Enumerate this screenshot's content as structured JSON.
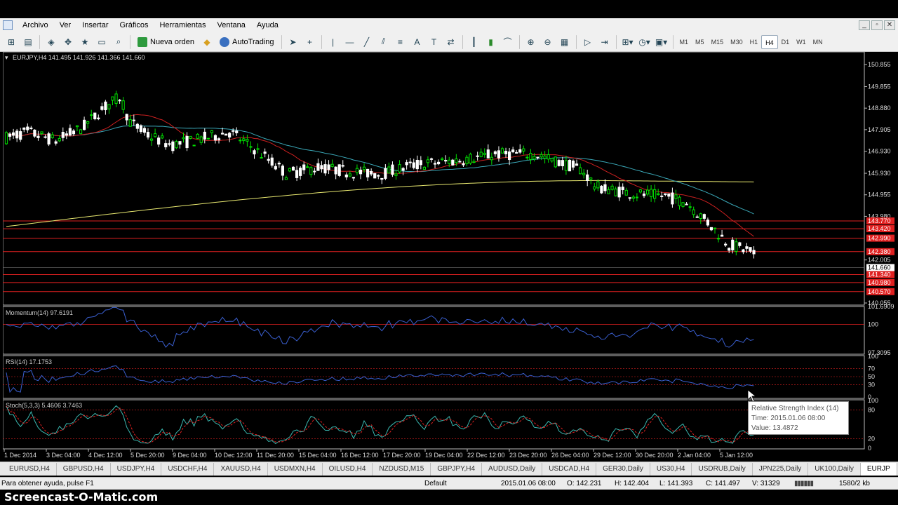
{
  "menu": [
    "Archivo",
    "Ver",
    "Insertar",
    "Gráficos",
    "Herramientas",
    "Ventana",
    "Ayuda"
  ],
  "window_controls": [
    "_",
    "▫",
    "✕"
  ],
  "toolbar": {
    "new_order": "Nueva orden",
    "autotrading": "AutoTrading",
    "timeframes": [
      "M1",
      "M5",
      "M15",
      "M30",
      "H1",
      "H4",
      "D1",
      "W1",
      "MN"
    ],
    "active_timeframe": "H4"
  },
  "chart": {
    "header": "EURJPY,H4  141.495 141.926 141.366 141.660",
    "price_axis": [
      "150.855",
      "149.855",
      "148.880",
      "147.905",
      "146.930",
      "145.930",
      "144.955",
      "143.980",
      "142.005",
      "141.660",
      "140.055"
    ],
    "red_levels": [
      {
        "price": 143.77,
        "label": "143.770"
      },
      {
        "price": 143.42,
        "label": "143.420"
      },
      {
        "price": 142.99,
        "label": "142.990"
      },
      {
        "price": 142.38,
        "label": "142.380"
      },
      {
        "price": 141.34,
        "label": "141.340"
      },
      {
        "price": 140.98,
        "label": "140.980"
      },
      {
        "price": 140.57,
        "label": "140.570"
      }
    ],
    "current_price": "141.660",
    "time_axis": [
      "1 Dec 2014",
      "3 Dec 04:00",
      "4 Dec 12:00",
      "5 Dec 20:00",
      "9 Dec 04:00",
      "10 Dec 12:00",
      "11 Dec 20:00",
      "15 Dec 04:00",
      "16 Dec 12:00",
      "17 Dec 20:00",
      "19 Dec 04:00",
      "22 Dec 12:00",
      "23 Dec 20:00",
      "26 Dec 04:00",
      "29 Dec 12:00",
      "30 Dec 20:00",
      "2 Jan 04:00",
      "5 Jan 12:00"
    ]
  },
  "momentum": {
    "label": "Momentum(14) 97.6191",
    "axis": [
      "101.6909",
      "100",
      "97.3095"
    ]
  },
  "rsi": {
    "label": "RSI(14) 17.1753",
    "axis": [
      "100",
      "70",
      "50",
      "30",
      "0"
    ]
  },
  "stoch": {
    "label": "Stoch(5,3,3) 5.4606 3.7463",
    "axis": [
      "100",
      "80",
      "20",
      "0"
    ]
  },
  "tooltip": {
    "title": "Relative Strength Index (14)",
    "time": "Time: 2015.01.06 08:00",
    "value": "Value: 13.4872"
  },
  "tabs": [
    "EURUSD,H4",
    "GBPUSD,H4",
    "USDJPY,H4",
    "USDCHF,H4",
    "XAUUSD,H4",
    "USDMXN,H4",
    "OILUSD,H4",
    "NZDUSD,M15",
    "GBPJPY,H4",
    "AUDUSD,Daily",
    "USDCAD,H4",
    "GER30,Daily",
    "US30,H4",
    "USDRUB,Daily",
    "JPN225,Daily",
    "UK100,Daily",
    "EURJP"
  ],
  "active_tab": "EURJP",
  "status": {
    "help": "Para obtener ayuda, pulse F1",
    "profile": "Default",
    "time": "2015.01.06 08:00",
    "open": "O: 142.231",
    "high": "H: 142.404",
    "low": "L: 141.393",
    "close": "C: 141.497",
    "volume": "V: 31329",
    "traffic": "1580/2 kb"
  },
  "watermark": "Screencast-O-Matic.com",
  "colors": {
    "bull": "#00e000",
    "bear": "#ffffff",
    "ma_fast": "#cc2020",
    "ma_mid": "#3aa8b8",
    "ma_slow": "#e8e870",
    "level": "#e02020",
    "indicator": "#3a5fd0",
    "signal": "#e02020"
  }
}
